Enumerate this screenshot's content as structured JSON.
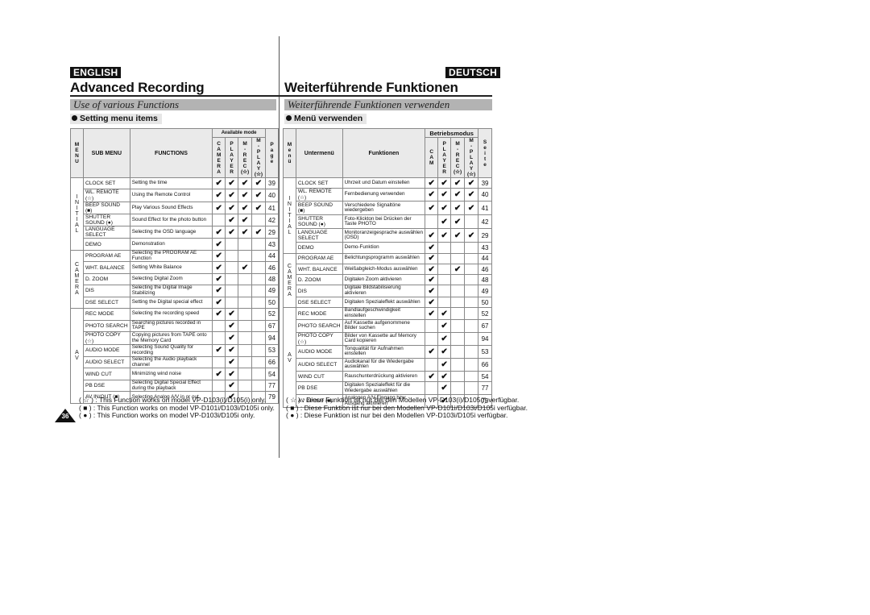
{
  "english": {
    "lang_badge": "ENGLISH",
    "title": "Advanced Recording",
    "section": "Use of various Functions",
    "subsection": "Setting menu items",
    "table": {
      "headers": {
        "menu": "M\nE\nN\nU",
        "sub_menu": "SUB MENU",
        "functions": "FUNCTIONS",
        "available_mode": "Available mode",
        "camera": "C\nA\nM\nE\nR\nA",
        "player": "P\nL\nA\nY\nE\nR",
        "mrec": "M\n-\nR\nE\nC\n(☆)",
        "mplay": "M\n-\nP\nL\nA\nY\n(☆)",
        "page": "P\na\ng\ne"
      },
      "groups": [
        {
          "label": "I\nN\nI\nT\nI\nA\nL",
          "rows": [
            {
              "sub": "CLOCK SET",
              "func": "Setting the time",
              "cam": true,
              "ply": true,
              "mrec": true,
              "mply": true,
              "page": "39"
            },
            {
              "sub": "WL. REMOTE (☆)",
              "func": "Using the Remote Control",
              "cam": true,
              "ply": true,
              "mrec": true,
              "mply": true,
              "page": "40"
            },
            {
              "sub": "BEEP SOUND (■)",
              "func": "Play Various Sound Effects",
              "cam": true,
              "ply": true,
              "mrec": true,
              "mply": true,
              "page": "41"
            },
            {
              "sub": "SHUTTER SOUND (●)",
              "func": "Sound Effect for the photo button",
              "cam": false,
              "ply": true,
              "mrec": true,
              "mply": false,
              "page": "42"
            },
            {
              "sub": "LANGUAGE SELECT",
              "func": "Selecting the OSD language",
              "cam": true,
              "ply": true,
              "mrec": true,
              "mply": true,
              "page": "29"
            },
            {
              "sub": "DEMO",
              "func": "Demonstration",
              "cam": true,
              "ply": false,
              "mrec": false,
              "mply": false,
              "page": "43"
            }
          ]
        },
        {
          "label": "C\nA\nM\nE\nR\nA",
          "rows": [
            {
              "sub": "PROGRAM AE",
              "func": "Selecting the PROGRAM AE Function",
              "cam": true,
              "ply": false,
              "mrec": false,
              "mply": false,
              "page": "44"
            },
            {
              "sub": "WHT. BALANCE",
              "func": "Setting White Balance",
              "cam": true,
              "ply": false,
              "mrec": true,
              "mply": false,
              "page": "46"
            },
            {
              "sub": "D. ZOOM",
              "func": "Selecting Digital Zoom",
              "cam": true,
              "ply": false,
              "mrec": false,
              "mply": false,
              "page": "48"
            },
            {
              "sub": "DIS",
              "func": "Selecting the Digital Image Stabilizing",
              "cam": true,
              "ply": false,
              "mrec": false,
              "mply": false,
              "page": "49"
            },
            {
              "sub": "DSE SELECT",
              "func": "Setting the Digital special effect",
              "cam": true,
              "ply": false,
              "mrec": false,
              "mply": false,
              "page": "50"
            }
          ]
        },
        {
          "label": "A\nV",
          "rows": [
            {
              "sub": "REC MODE",
              "func": "Selecting the recording speed",
              "cam": true,
              "ply": true,
              "mrec": false,
              "mply": false,
              "page": "52"
            },
            {
              "sub": "PHOTO SEARCH",
              "func": "Searching pictures recorded in TAPE",
              "cam": false,
              "ply": true,
              "mrec": false,
              "mply": false,
              "page": "67"
            },
            {
              "sub": "PHOTO COPY (☆)",
              "func": "Copying pictures from TAPE onto the Memory Card",
              "cam": false,
              "ply": true,
              "mrec": false,
              "mply": false,
              "page": "94"
            },
            {
              "sub": "AUDIO MODE",
              "func": "Selecting Sound Quality for recording",
              "cam": true,
              "ply": true,
              "mrec": false,
              "mply": false,
              "page": "53"
            },
            {
              "sub": "AUDIO SELECT",
              "func": "Selecting the Audio playback channel",
              "cam": false,
              "ply": true,
              "mrec": false,
              "mply": false,
              "page": "66"
            },
            {
              "sub": "WIND CUT",
              "func": "Minimizing wind noise",
              "cam": true,
              "ply": true,
              "mrec": false,
              "mply": false,
              "page": "54"
            },
            {
              "sub": "PB DSE",
              "func": "Selecting Digital Special Effect during the playback",
              "cam": false,
              "ply": true,
              "mrec": false,
              "mply": false,
              "page": "77"
            },
            {
              "sub": "AV IN/OUT (■)",
              "func": "Selecting Analog A/V in or out",
              "cam": false,
              "ply": true,
              "mrec": false,
              "mply": false,
              "page": "79"
            }
          ]
        }
      ]
    },
    "notes": [
      "( ☆ ) : This Function works on model VP-D103(i)/D105(i) only.",
      "( ■ ) : This Function works on model VP-D101i/D103i/D105i only.",
      "( ● ) : This Function works on model VP-D103i/D105i only."
    ],
    "page_number": "36"
  },
  "deutsch": {
    "lang_badge": "DEUTSCH",
    "title": "Weiterführende Funktionen",
    "section": "Weiterführende Funktionen verwenden",
    "subsection": "Menü verwenden",
    "table": {
      "headers": {
        "menu": "M\ne\nn\nü",
        "sub_menu": "Untermenü",
        "functions": "Funktionen",
        "available_mode": "Betriebsmodus",
        "camera": "C\nA\nM",
        "player": "P\nL\nA\nY\nE\nR",
        "mrec": "M\n-\nR\nE\nC\n(☆)",
        "mplay": "M\n-\nP\nL\nA\nY\n(☆)",
        "page": "S\ne\ni\nt\ne"
      },
      "groups": [
        {
          "label": "I\nN\nI\nT\nI\nA\nL",
          "rows": [
            {
              "sub": "CLOCK SET",
              "func": "Uhrzeit und Datum einstellen",
              "cam": true,
              "ply": true,
              "mrec": true,
              "mply": true,
              "page": "39"
            },
            {
              "sub": "WL. REMOTE (☆)",
              "func": "Fernbedienung verwenden",
              "cam": true,
              "ply": true,
              "mrec": true,
              "mply": true,
              "page": "40"
            },
            {
              "sub": "BEEP SOUND (■)",
              "func": "Verschiedene Signaltöne wiedergeben",
              "cam": true,
              "ply": true,
              "mrec": true,
              "mply": true,
              "page": "41"
            },
            {
              "sub": "SHUTTER SOUND (●)",
              "func": "Foto-Klickton bei Drücken der Taste PHOTO",
              "cam": false,
              "ply": true,
              "mrec": true,
              "mply": false,
              "page": "42"
            },
            {
              "sub": "LANGUAGE SELECT",
              "func": "Monitoranzeigesprache auswählen (OSD)",
              "cam": true,
              "ply": true,
              "mrec": true,
              "mply": true,
              "page": "29"
            },
            {
              "sub": "DEMO",
              "func": "Demo-Funktion",
              "cam": true,
              "ply": false,
              "mrec": false,
              "mply": false,
              "page": "43"
            }
          ]
        },
        {
          "label": "C\nA\nM\nE\nR\nA",
          "rows": [
            {
              "sub": "PROGRAM AE",
              "func": "Belichtungsprogramm auswählen",
              "cam": true,
              "ply": false,
              "mrec": false,
              "mply": false,
              "page": "44"
            },
            {
              "sub": "WHT. BALANCE",
              "func": "Weißabgleich-Modus auswählen",
              "cam": true,
              "ply": false,
              "mrec": true,
              "mply": false,
              "page": "46"
            },
            {
              "sub": "D. ZOOM",
              "func": "Digitalen Zoom aktivieren",
              "cam": true,
              "ply": false,
              "mrec": false,
              "mply": false,
              "page": "48"
            },
            {
              "sub": "DIS",
              "func": "Digitale Bildstabilisierung aktivieren",
              "cam": true,
              "ply": false,
              "mrec": false,
              "mply": false,
              "page": "49"
            },
            {
              "sub": "DSE SELECT",
              "func": "Digitalen Spezialeffekt auswählen",
              "cam": true,
              "ply": false,
              "mrec": false,
              "mply": false,
              "page": "50"
            }
          ]
        },
        {
          "label": "A\nV",
          "rows": [
            {
              "sub": "REC MODE",
              "func": "Bandlaufgeschwindigkeit einstellen",
              "cam": true,
              "ply": true,
              "mrec": false,
              "mply": false,
              "page": "52"
            },
            {
              "sub": "PHOTO SEARCH",
              "func": "Auf Kassette aufgenommene Bilder suchen",
              "cam": false,
              "ply": true,
              "mrec": false,
              "mply": false,
              "page": "67"
            },
            {
              "sub": "PHOTO COPY (☆)",
              "func": "Bilder von Kassette auf Memory Card kopieren",
              "cam": false,
              "ply": true,
              "mrec": false,
              "mply": false,
              "page": "94"
            },
            {
              "sub": "AUDIO MODE",
              "func": "Tonqualität für Aufnahmen einstellen",
              "cam": true,
              "ply": true,
              "mrec": false,
              "mply": false,
              "page": "53"
            },
            {
              "sub": "AUDIO SELECT",
              "func": "Audiokanal für die Wiedergabe auswählen",
              "cam": false,
              "ply": true,
              "mrec": false,
              "mply": false,
              "page": "66"
            },
            {
              "sub": "WIND CUT",
              "func": "Rauschunterdrückung aktivieren",
              "cam": true,
              "ply": true,
              "mrec": false,
              "mply": false,
              "page": "54"
            },
            {
              "sub": "PB DSE",
              "func": "Digitalen Spezialeffekt für die Wiedergabe auswählen",
              "cam": false,
              "ply": true,
              "mrec": false,
              "mply": false,
              "page": "77"
            },
            {
              "sub": "AV IN/OUT (■)",
              "func": "Analogen A/V-Eingang bzw. -Ausgang aktivieren",
              "cam": false,
              "ply": true,
              "mrec": false,
              "mply": false,
              "page": "79"
            }
          ]
        }
      ]
    },
    "notes": [
      "( ☆ ) : Diese Funktion ist nur bei den Modellen VP-D103(i)/D105(i) verfügbar.",
      "( ■ ) : Diese Funktion ist nur bei den Modellen VP-D101i/D103i/D105i verfügbar.",
      "( ● ) : Diese Funktion ist nur bei den Modellen VP-D103i/D105i verfügbar."
    ]
  },
  "check_mark": "✔"
}
